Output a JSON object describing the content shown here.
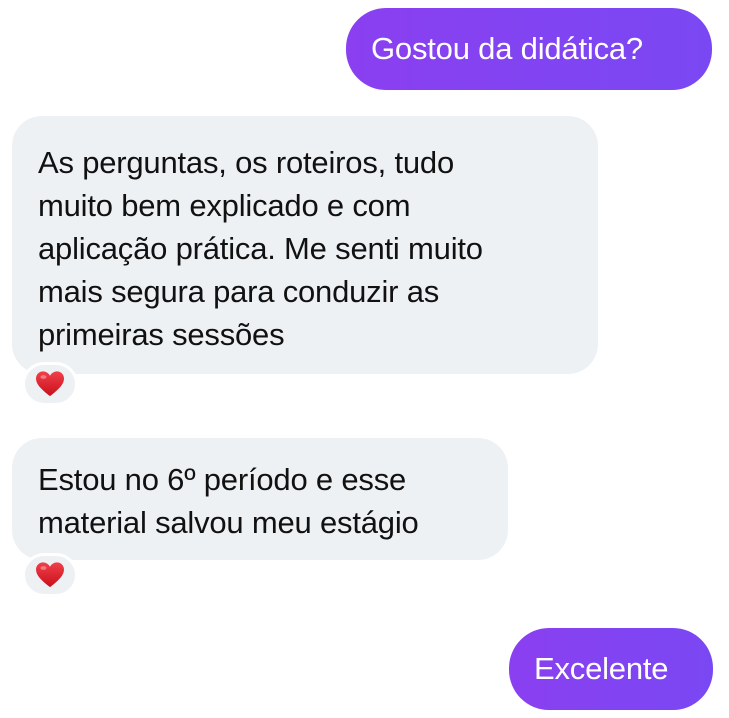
{
  "colors": {
    "outgoing_bubble_start": "#8a3ff0",
    "outgoing_bubble_end": "#7a48f3",
    "incoming_bubble": "#eef1f4",
    "reaction_heart": "#e0202a"
  },
  "messages": [
    {
      "direction": "outgoing",
      "text": "Gostou da didática?"
    },
    {
      "direction": "incoming",
      "lines": [
        "As perguntas, os roteiros, tudo",
        "muito bem explicado e com",
        "aplicação prática. Me senti muito",
        "mais segura para conduzir as",
        "primeiras sessões"
      ],
      "reaction": "heart-icon"
    },
    {
      "direction": "incoming",
      "lines": [
        "Estou no 6º período e esse",
        "material salvou meu estágio"
      ],
      "reaction": "heart-icon"
    },
    {
      "direction": "outgoing",
      "text": "Excelente"
    }
  ]
}
